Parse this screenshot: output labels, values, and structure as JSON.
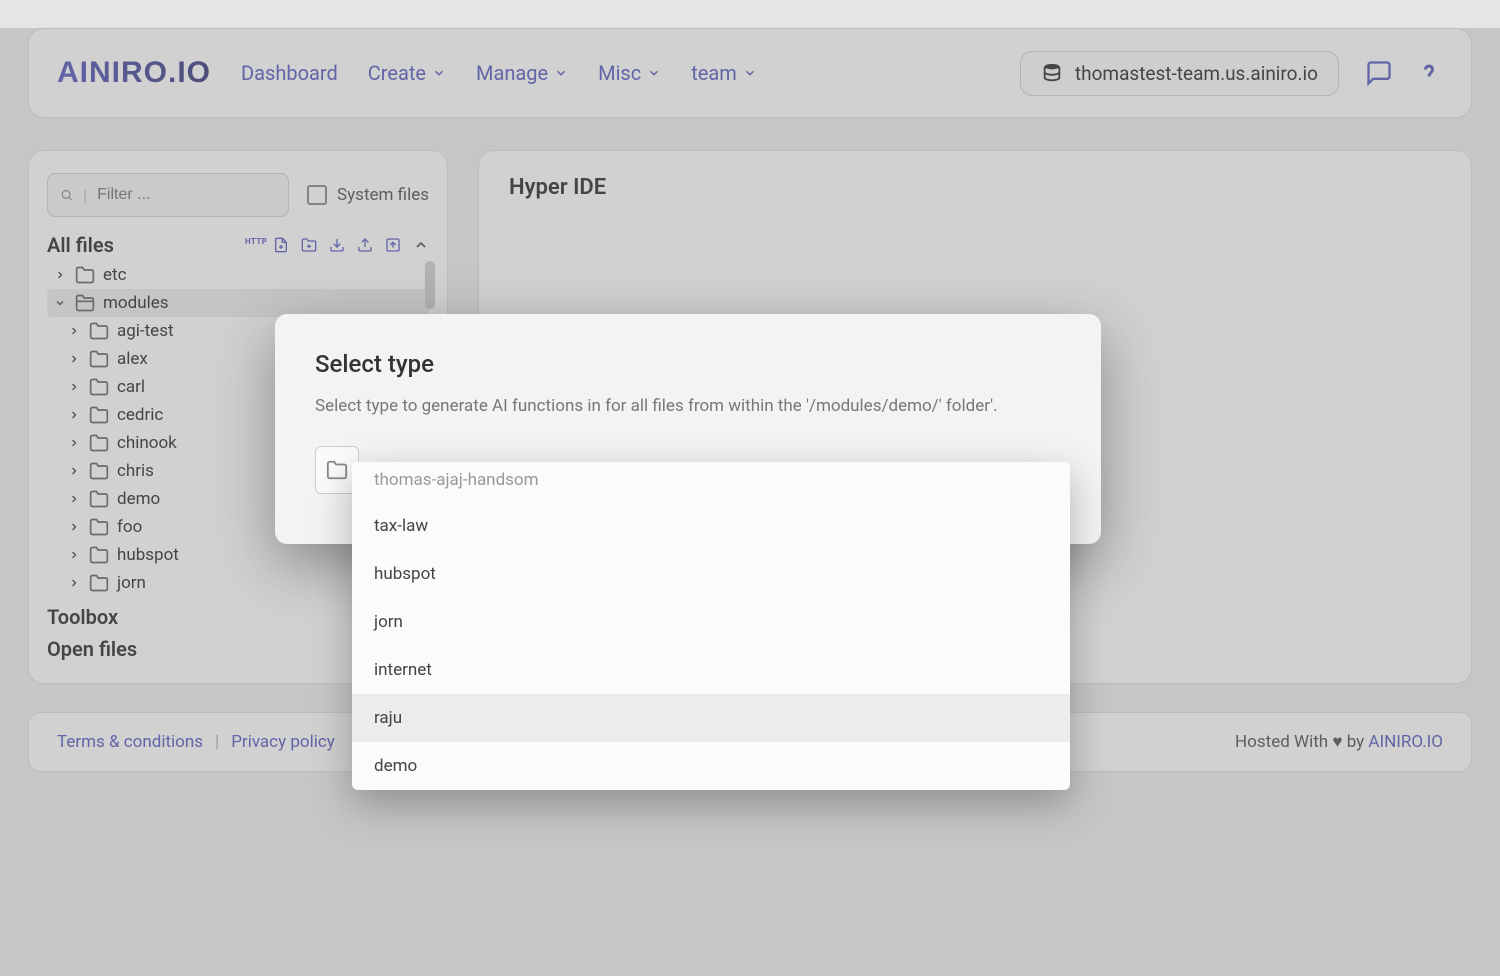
{
  "brand": "AINIRO.IO",
  "nav": {
    "dashboard": "Dashboard",
    "create": "Create",
    "manage": "Manage",
    "misc": "Misc",
    "team": "team"
  },
  "db_host": "thomastest-team.us.ainiro.io",
  "sidebar": {
    "filter_placeholder": "Filter ...",
    "system_files": "System files",
    "all_files": "All files",
    "tree": {
      "root_items": [
        "etc",
        "modules"
      ],
      "modules_children": [
        "agi-test",
        "alex",
        "carl",
        "cedric",
        "chinook",
        "chris",
        "demo",
        "foo",
        "hubspot",
        "jorn"
      ]
    },
    "toolbox": "Toolbox",
    "open_files": "Open files"
  },
  "content": {
    "title": "Hyper IDE"
  },
  "footer": {
    "terms": "Terms & conditions",
    "privacy": "Privacy policy",
    "hosted_prefix": "Hosted With",
    "hosted_by": "by",
    "hosted_link": "AINIRO.IO"
  },
  "modal": {
    "title": "Select type",
    "description": "Select type to generate AI functions in for all files from within the '/modules/demo/' folder'."
  },
  "dropdown": {
    "items": [
      "thomas-ajaj-handsom",
      "tax-law",
      "hubspot",
      "jorn",
      "internet",
      "raju",
      "demo"
    ],
    "hover_index": 5
  }
}
